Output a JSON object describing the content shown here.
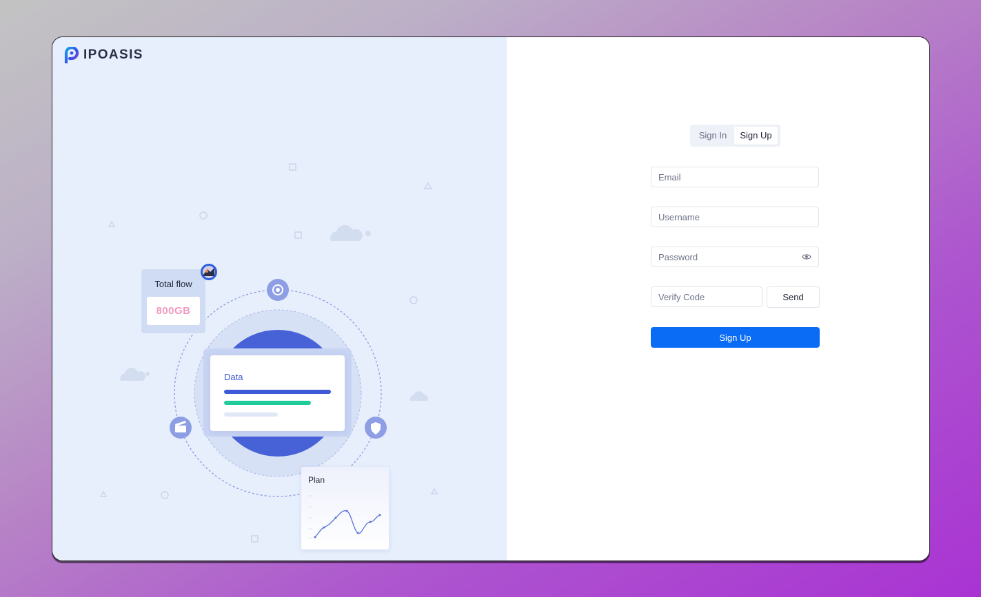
{
  "brand": {
    "name": "IPOASIS",
    "colors": {
      "logo_blue": "#2d59e6",
      "logo_purple": "#8b3fe0",
      "primary": "#0a6cf5"
    }
  },
  "illustration": {
    "total_flow_label": "Total flow",
    "total_flow_value": "800GB",
    "data_card_title": "Data",
    "plan_card_title": "Plan",
    "orbit_icons": [
      "target-icon",
      "clapperboard-icon",
      "shield-icon"
    ]
  },
  "auth": {
    "tabs": [
      {
        "label": "Sign In",
        "active": false
      },
      {
        "label": "Sign Up",
        "active": true
      }
    ],
    "fields": {
      "email": {
        "placeholder": "Email",
        "value": ""
      },
      "username": {
        "placeholder": "Username",
        "value": ""
      },
      "password": {
        "placeholder": "Password",
        "value": ""
      },
      "verify_code": {
        "placeholder": "Verify Code",
        "value": ""
      }
    },
    "send_label": "Send",
    "submit_label": "Sign Up"
  }
}
